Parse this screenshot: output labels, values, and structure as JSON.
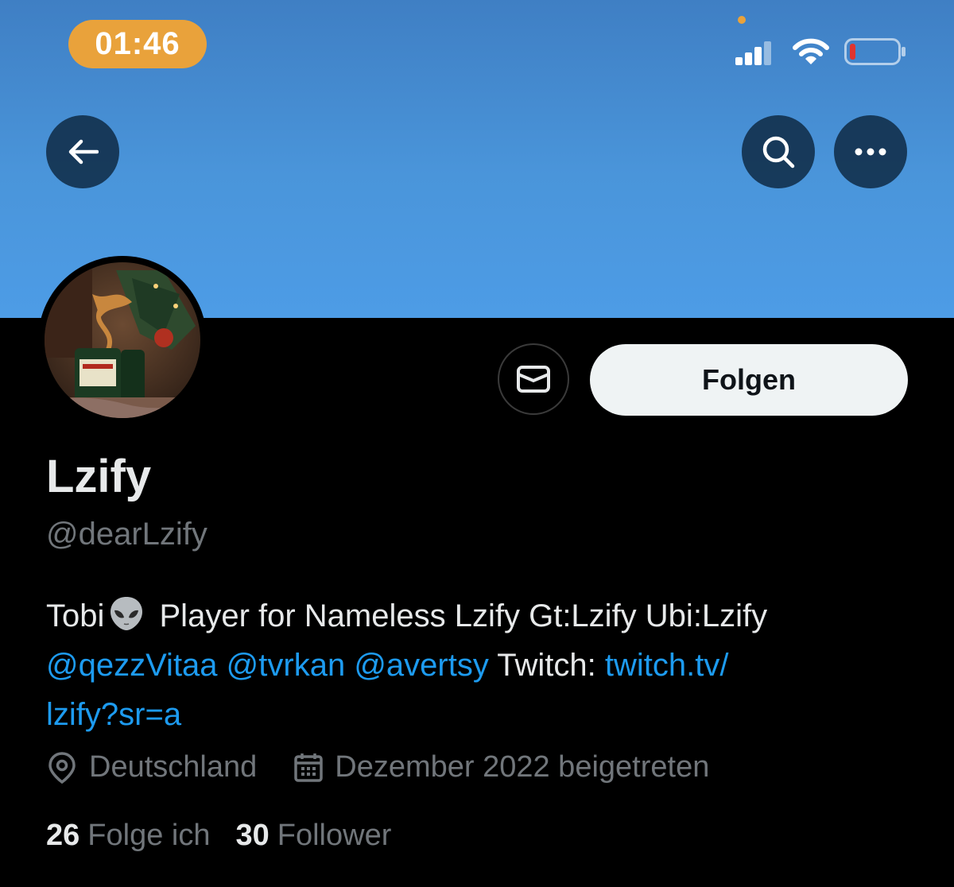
{
  "status_bar": {
    "time": "01:46",
    "accent_color": "#e9a23b",
    "icons": [
      "signal-icon",
      "wifi-icon",
      "battery-icon"
    ]
  },
  "header": {
    "icons": [
      "back-arrow-icon",
      "search-icon",
      "more-icon"
    ]
  },
  "profile": {
    "display_name": "Lzify",
    "handle": "@dearLzify",
    "message_icon": "mail-icon",
    "follow_label": "Folgen",
    "bio": {
      "text_1": "Tobi",
      "emoji": "alien-emoji",
      "text_2": " Player for Nameless Lzify Gt:Lzify Ubi:Lzify",
      "mention_1": "@qezzVitaa",
      "mention_2": "@tvrkan",
      "mention_3": "@avertsy",
      "twitch_label": " Twitch: ",
      "twitch_link_1": "twitch.tv/",
      "twitch_link_2": "lzify?sr=a"
    },
    "location": "Deutschland",
    "joined": "Dezember 2022 beigetreten",
    "following_count": "26",
    "following_label": "Folge ich",
    "followers_count": "30",
    "followers_label": "Follower"
  },
  "colors": {
    "banner": "#4a95da",
    "link": "#1d9bf0",
    "secondary_text": "#71767b",
    "primary_text": "#e7e9ea"
  }
}
